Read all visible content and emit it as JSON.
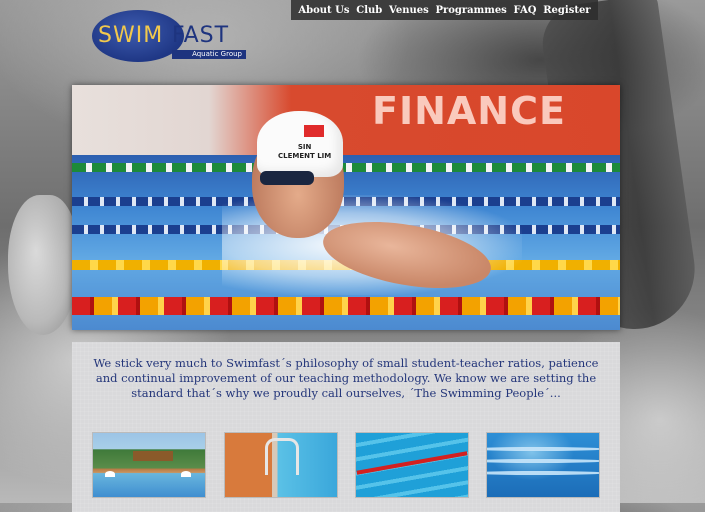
{
  "logo": {
    "word_left": "SWIM",
    "word_right": "FAST",
    "tagline": "Aquatic Group",
    "colors": {
      "oval": "#2b4a9e",
      "swim": "#f2c94c",
      "fast": "#1e347f"
    }
  },
  "nav": {
    "items": [
      "About Us",
      "Club",
      "Venues",
      "Programmes",
      "FAQ",
      "Register"
    ]
  },
  "hero": {
    "sponsor_text": "FINANCE",
    "cap_text": [
      "SIN",
      "CLEMENT LIM"
    ]
  },
  "intro": {
    "text": "We stick very much to Swimfast´s philosophy of small student-teacher ratios, patience and continual improvement of our teaching methodology. We know we are setting the standard that´s why we proudly call ourselves, ´The Swimming People´..."
  },
  "thumbnails": [
    {
      "subject": "outdoor-resort-pool"
    },
    {
      "subject": "pool-ladder"
    },
    {
      "subject": "swimmers-in-lanes"
    },
    {
      "subject": "pool-steps"
    }
  ]
}
